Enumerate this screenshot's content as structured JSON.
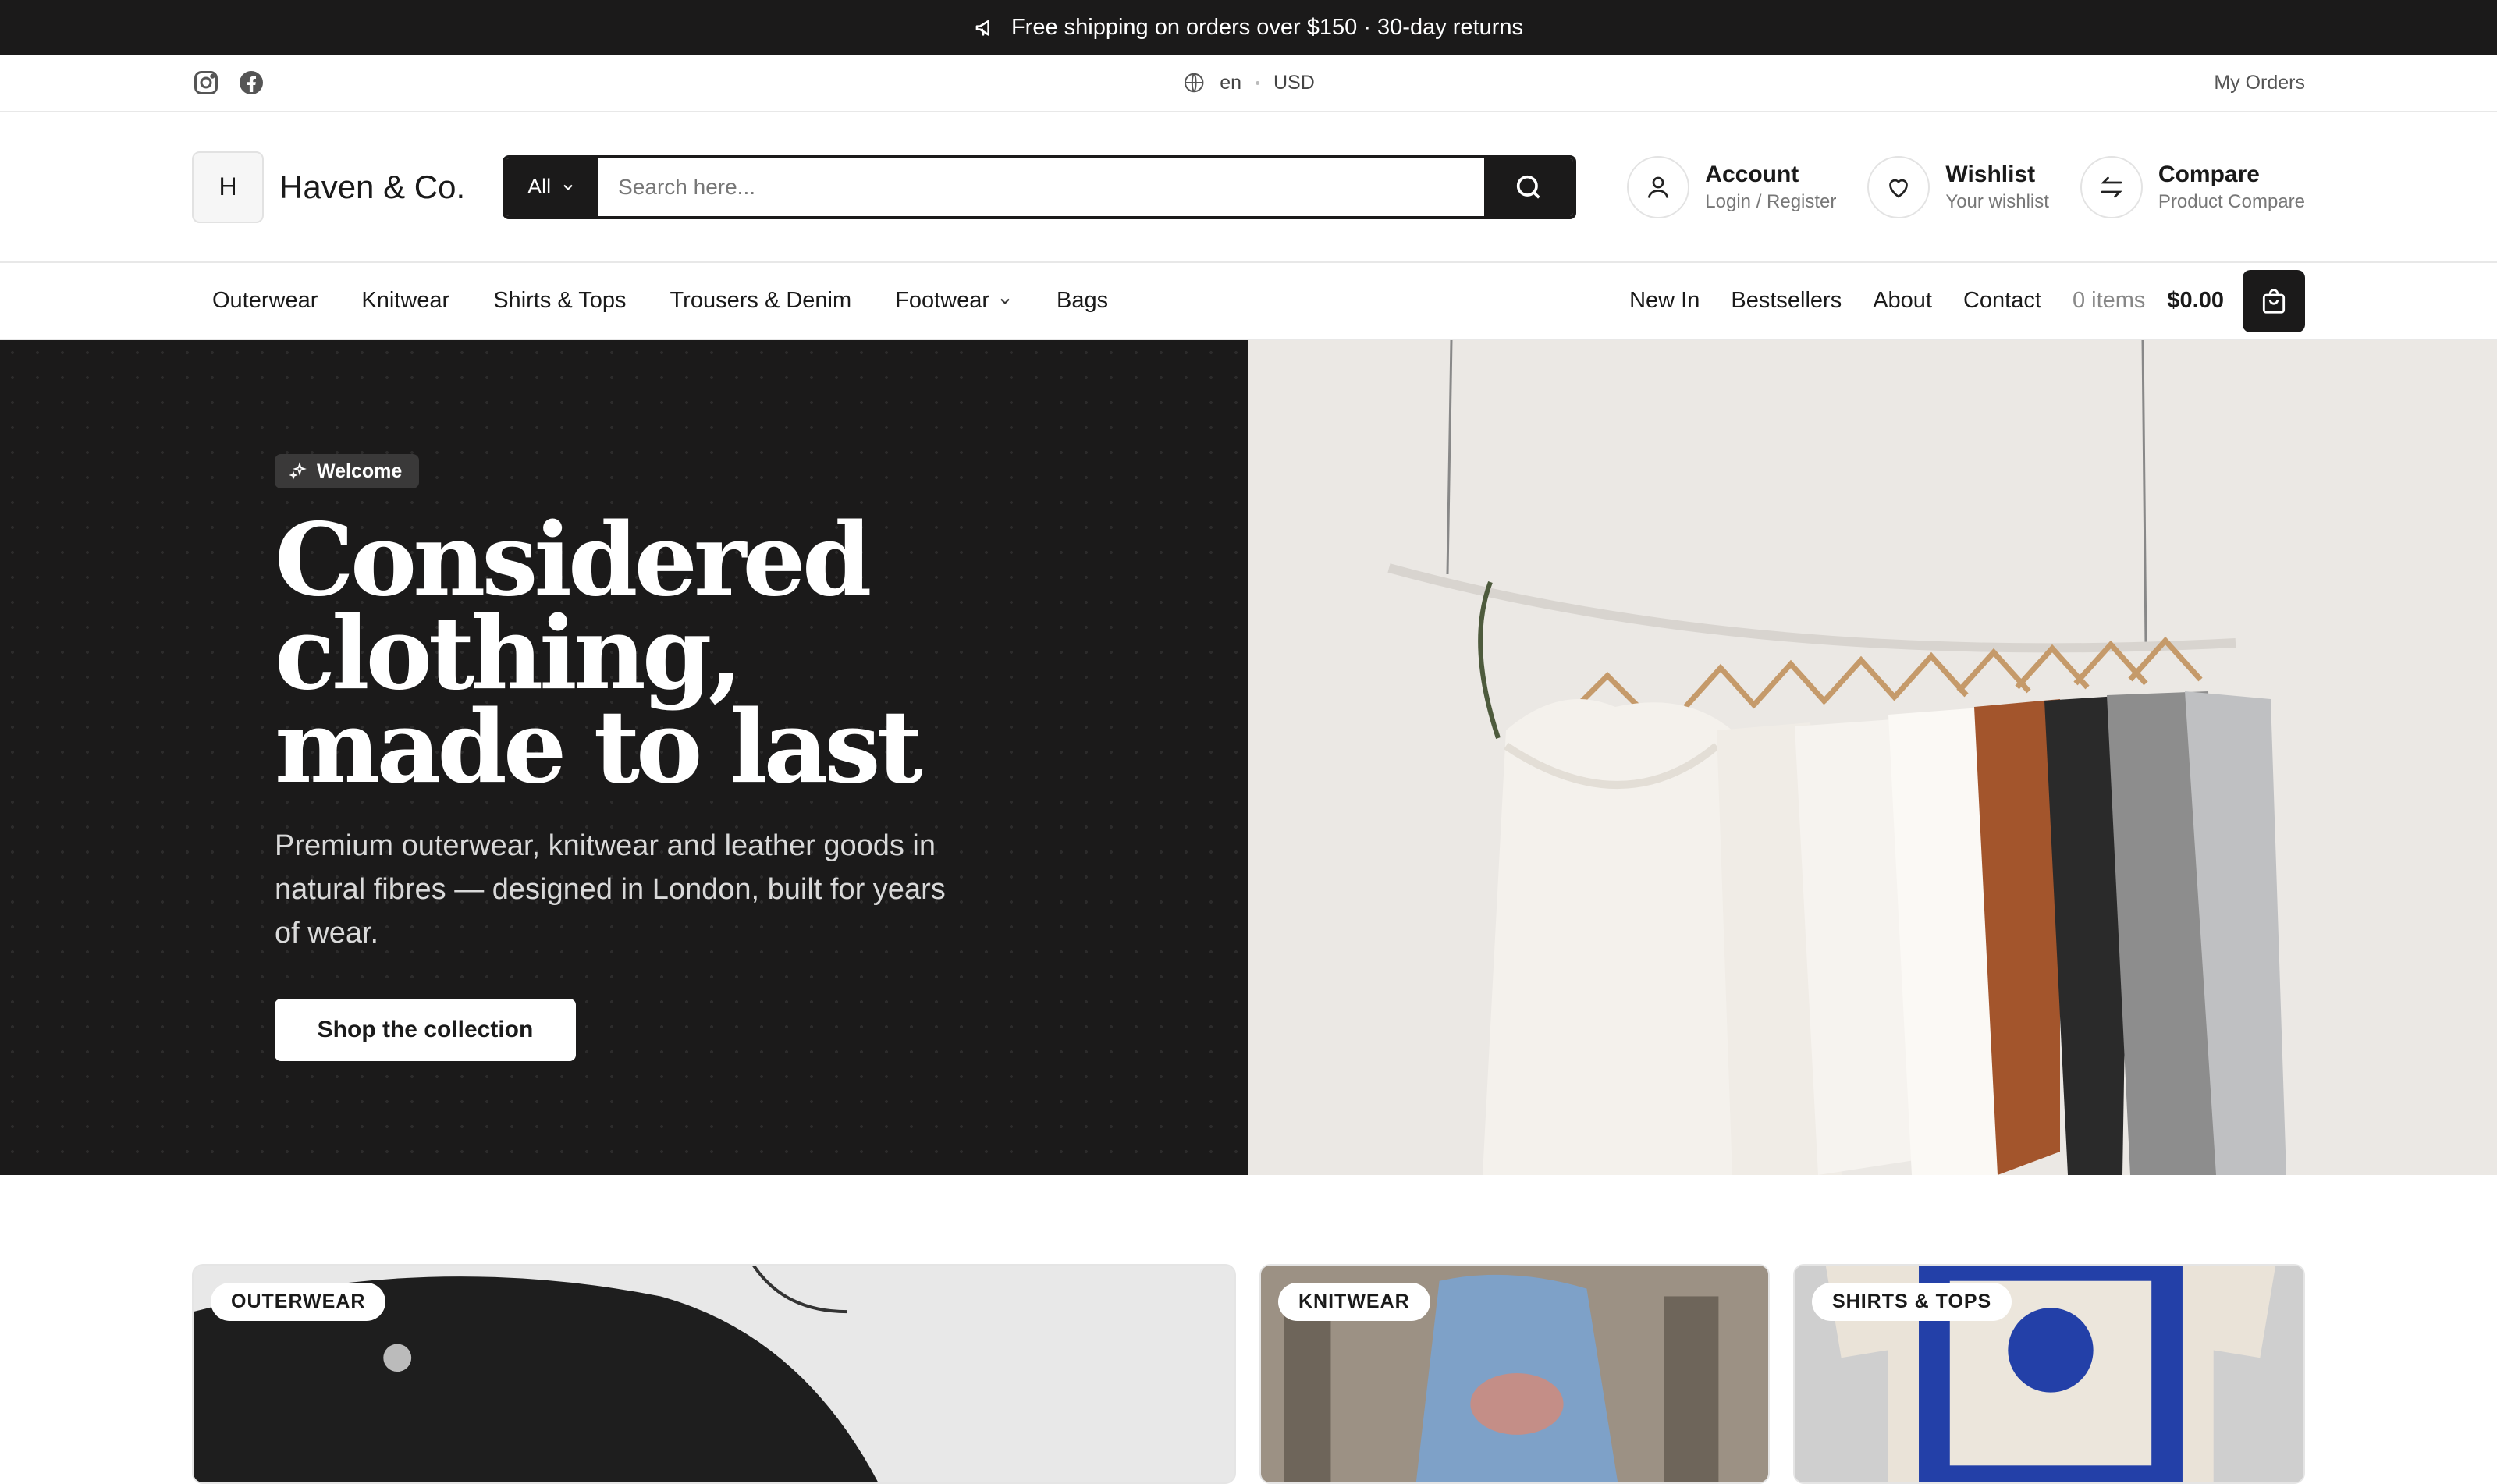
{
  "announcement": {
    "text": "Free shipping on orders over $150 · 30-day returns",
    "icon": "megaphone-icon"
  },
  "utility": {
    "language": "en",
    "currency": "USD",
    "orders_link": "My Orders",
    "social": [
      "instagram-icon",
      "facebook-icon"
    ]
  },
  "brand": {
    "monogram": "H",
    "name": "Haven & Co."
  },
  "search": {
    "category": "All",
    "placeholder": "Search here..."
  },
  "header_actions": [
    {
      "title": "Account",
      "subtitle": "Login / Register",
      "icon": "user-icon"
    },
    {
      "title": "Wishlist",
      "subtitle": "Your wishlist",
      "icon": "heart-icon"
    },
    {
      "title": "Compare",
      "subtitle": "Product Compare",
      "icon": "compare-arrows-icon"
    }
  ],
  "nav": {
    "categories": [
      "Outerwear",
      "Knitwear",
      "Shirts & Tops",
      "Trousers & Denim",
      "Footwear",
      "Bags"
    ],
    "links": [
      "New In",
      "Bestsellers",
      "About",
      "Contact"
    ],
    "cart_items": "0 items",
    "cart_total": "$0.00"
  },
  "hero": {
    "badge": "Welcome",
    "headline": [
      "Considered",
      "clothing,",
      "made to last"
    ],
    "subtitle": "Premium outerwear, knitwear and leather goods in natural fibres — designed in London, built for years of wear.",
    "cta": "Shop the collection"
  },
  "collections": [
    {
      "label": "OUTERWEAR"
    },
    {
      "label": "KNITWEAR"
    },
    {
      "label": "SHIRTS & TOPS"
    }
  ],
  "colors": {
    "dark": "#1b1a1a",
    "white": "#ffffff",
    "muted": "#777777"
  }
}
